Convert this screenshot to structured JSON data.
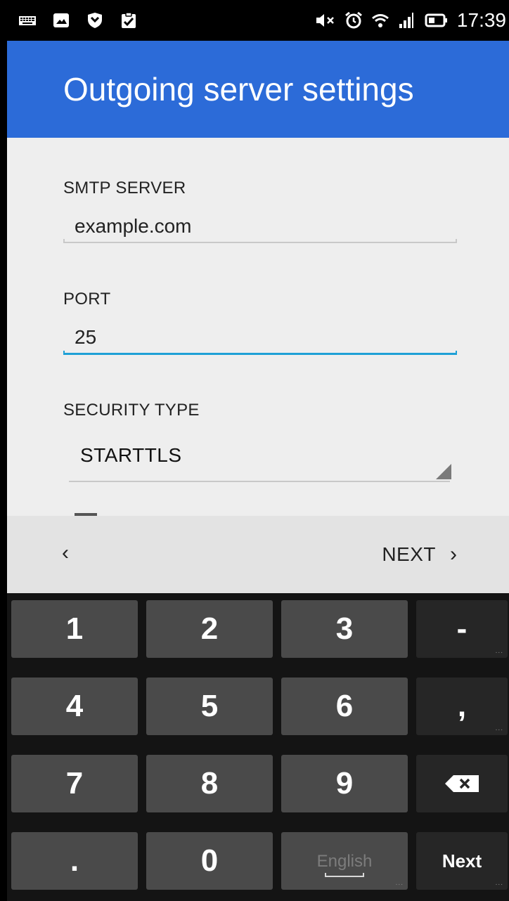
{
  "status_bar": {
    "time": "17:39",
    "left_icons": [
      "keyboard-icon",
      "image-icon",
      "shield-icon",
      "clipboard-check-icon"
    ],
    "right_icons": [
      "mute-icon",
      "alarm-icon",
      "wifi-icon",
      "signal-icon",
      "battery-icon"
    ]
  },
  "app_bar": {
    "title": "Outgoing server settings"
  },
  "form": {
    "smtp_server": {
      "label": "SMTP SERVER",
      "value": "example.com"
    },
    "port": {
      "label": "PORT",
      "value": "25"
    },
    "security_type": {
      "label": "SECURITY TYPE",
      "selected": "STARTTLS"
    }
  },
  "nav": {
    "prev_glyph": "‹",
    "next_label": "NEXT",
    "next_glyph": "›"
  },
  "keyboard": {
    "rows": [
      [
        "1",
        "2",
        "3",
        "-"
      ],
      [
        "4",
        "5",
        "6",
        ","
      ],
      [
        "7",
        "8",
        "9",
        "⌫"
      ],
      [
        ".",
        "0",
        "English",
        "Next"
      ]
    ],
    "space_key_label": "English",
    "action_key_label": "Next"
  },
  "colors": {
    "app_bar": "#2c6bd8",
    "content_bg": "#eeeeee",
    "focus_line": "#1ea0d6",
    "nav_bg": "#e3e3e3",
    "key": "#4a4a4a",
    "key_dark": "#262626"
  }
}
